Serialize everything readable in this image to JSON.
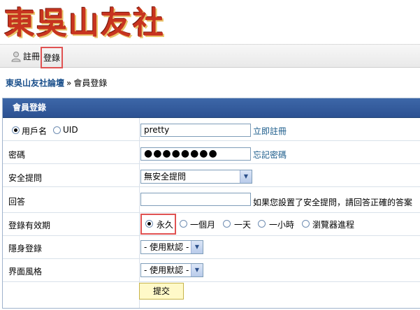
{
  "logo": {
    "text": "東吳山友社"
  },
  "topnav": {
    "register": "註冊",
    "login": "登錄"
  },
  "breadcrumb": {
    "forum": "東吳山友社論壇",
    "separator": "»",
    "current": "會員登錄"
  },
  "form": {
    "title": "會員登錄",
    "login_type": {
      "options": [
        "用戶名",
        "UID"
      ],
      "selected": "用戶名"
    },
    "username_value": "pretty",
    "register_link": "立即註冊",
    "password_label": "密碼",
    "password_dots": "●●●●●●●●",
    "forgot_link": "忘記密碼",
    "security_label": "安全提問",
    "security_value": "無安全提問",
    "answer_label": "回答",
    "answer_hint": "如果您設置了安全提問，請回答正確的答案",
    "expiry_label": "登錄有效期",
    "expiry_options": [
      "永久",
      "一個月",
      "一天",
      "一小時",
      "瀏覽器進程"
    ],
    "expiry_selected": "永久",
    "invisible_label": "隱身登錄",
    "invisible_value": "- 使用默認 -",
    "style_label": "界面風格",
    "style_value": "- 使用默認 -",
    "submit_label": "提交"
  },
  "colors": {
    "header_blue": "#2c5192",
    "link_blue": "#1a5b8a",
    "highlight_red": "#e05252",
    "submit_bg": "#fff9c8"
  },
  "icons": {
    "user": "user-icon",
    "dropdown": "chevron-down-icon"
  }
}
